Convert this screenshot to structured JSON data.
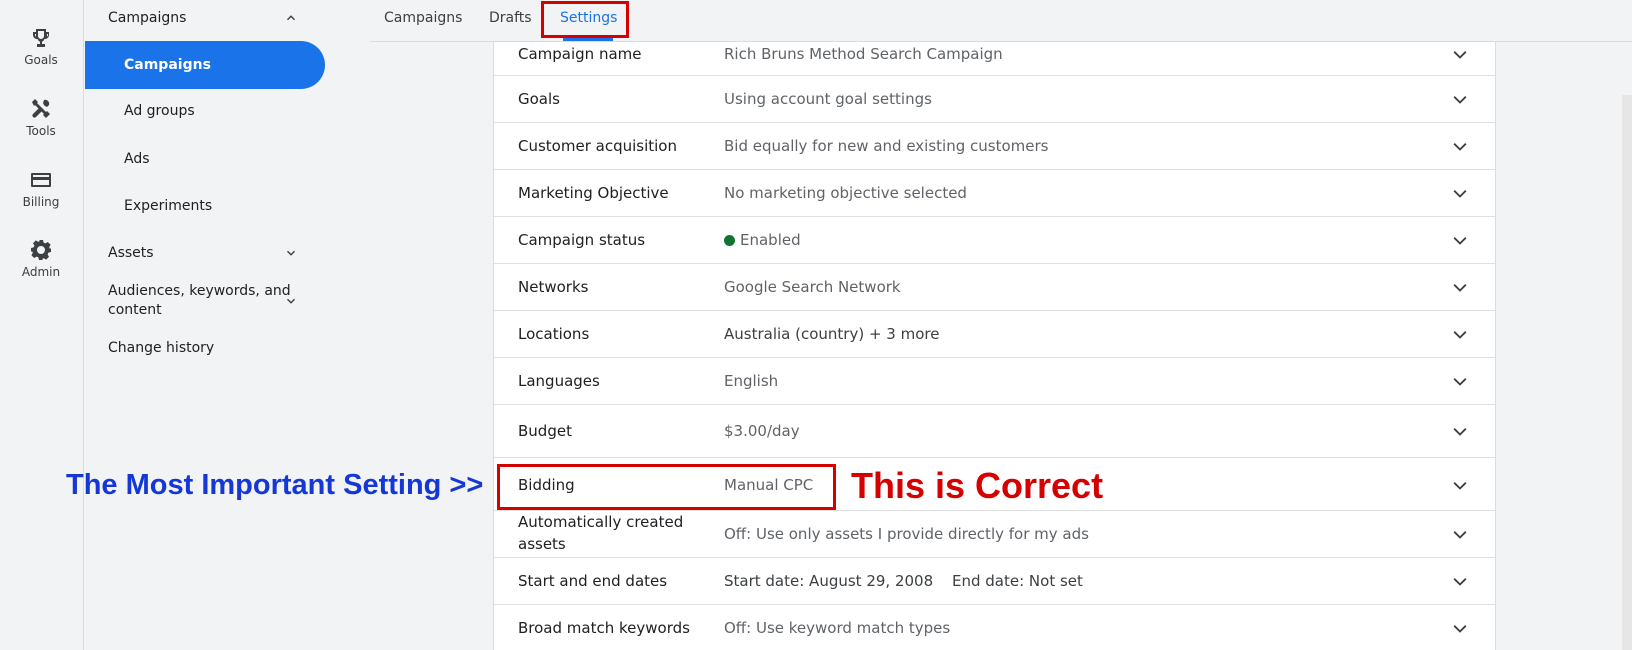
{
  "rail": [
    {
      "label": "Goals",
      "icon": "trophy-icon"
    },
    {
      "label": "Tools",
      "icon": "tools-icon"
    },
    {
      "label": "Billing",
      "icon": "credit-card-icon"
    },
    {
      "label": "Admin",
      "icon": "gear-icon"
    }
  ],
  "nav": {
    "campaigns_section": "Campaigns",
    "campaigns": "Campaigns",
    "ad_groups": "Ad groups",
    "ads": "Ads",
    "experiments": "Experiments",
    "assets": "Assets",
    "audiences_line1": "Audiences, keywords, and",
    "audiences_line2": "content",
    "change_history": "Change history"
  },
  "tabs": [
    "Campaigns",
    "Drafts",
    "Settings"
  ],
  "active_tab": "Settings",
  "settings": [
    {
      "name": "Campaign name",
      "value": "Rich Bruns Method Search Campaign"
    },
    {
      "name": "Goals",
      "value": "Using account goal settings"
    },
    {
      "name": "Customer acquisition",
      "value": "Bid equally for new and existing customers"
    },
    {
      "name": "Marketing Objective",
      "value": "No marketing objective selected"
    },
    {
      "name": "Campaign status",
      "value": "Enabled"
    },
    {
      "name": "Networks",
      "value": "Google Search Network"
    },
    {
      "name": "Locations",
      "value": "Australia (country) + 3 more"
    },
    {
      "name": "Languages",
      "value": "English"
    },
    {
      "name": "Budget",
      "value": "$3.00/day"
    },
    {
      "name": "Bidding",
      "value": "Manual CPC"
    },
    {
      "name_line1": "Automatically created",
      "name_line2": "assets",
      "value": "Off: Use only assets I provide directly for my ads"
    },
    {
      "name": "Start and end dates",
      "value_start": "Start date: August 29, 2008",
      "value_end": "End date: Not set"
    },
    {
      "name": "Broad match keywords",
      "value": "Off: Use keyword match types"
    }
  ],
  "annotations": {
    "left": "The Most Important Setting >>",
    "right": "This is Correct"
  },
  "colors": {
    "accent": "#1a73e8",
    "annotation_red": "#d50000",
    "annotation_blue": "#1537d6",
    "status_green": "#137333"
  }
}
